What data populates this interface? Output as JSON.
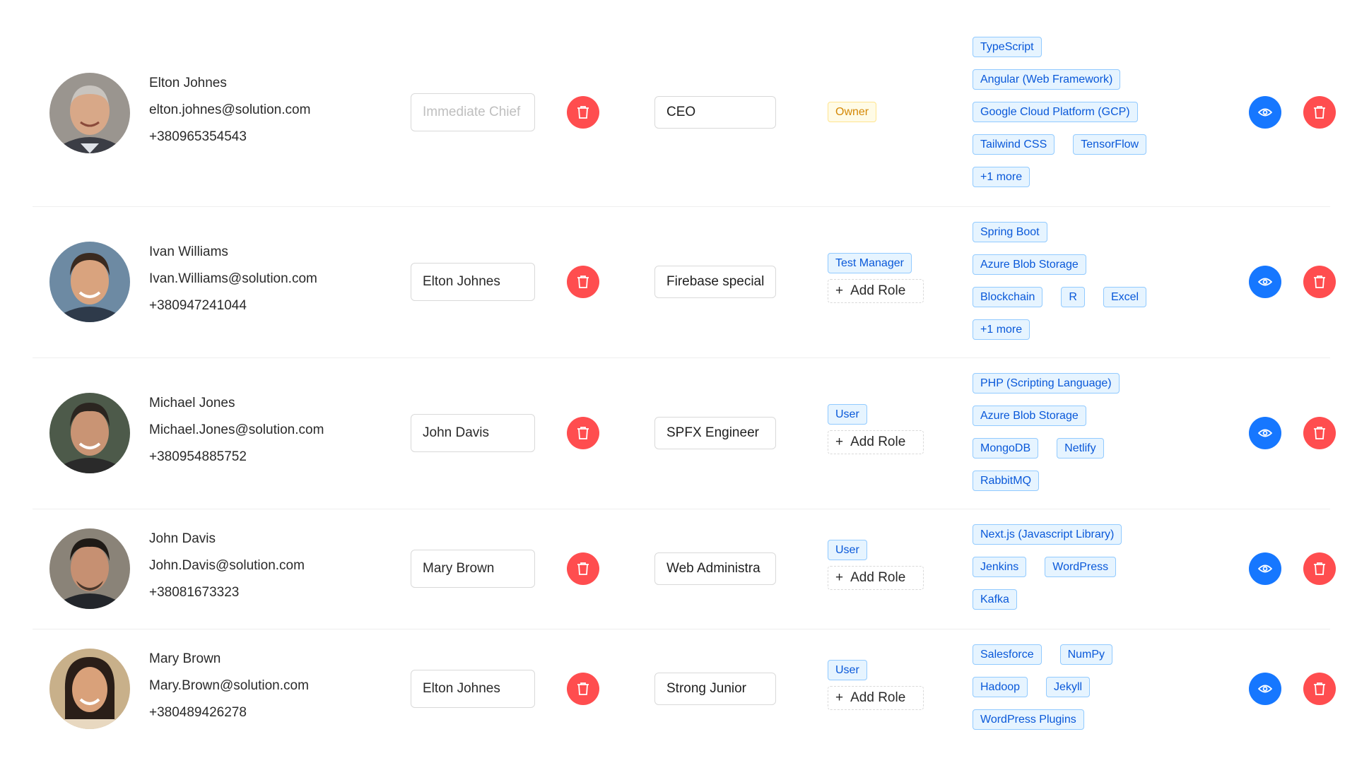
{
  "list": {
    "chief_placeholder": "Immediate Chief",
    "add_role_label": "Add Role",
    "colors": {
      "danger": "#ff4d4f",
      "primary": "#1677ff",
      "tag_blue_bg": "#e6f4ff",
      "tag_blue_border": "#91caff",
      "tag_blue_text": "#0958d9",
      "tag_gold_bg": "#fffbe6",
      "tag_gold_border": "#ffe58f",
      "tag_gold_text": "#d48806"
    },
    "employees": [
      {
        "name": "Elton Johnes",
        "email": "elton.johnes@solution.com",
        "phone": "+380965354543",
        "chief": "",
        "title": "CEO",
        "roles": [
          "Owner"
        ],
        "skills": [
          [
            "TypeScript"
          ],
          [
            "Angular (Web Framework)"
          ],
          [
            "Google Cloud Platform (GCP)"
          ],
          [
            "Tailwind CSS",
            "TensorFlow"
          ],
          [
            "+1 more"
          ]
        ]
      },
      {
        "name": "Ivan Williams",
        "email": "Ivan.Williams@solution.com",
        "phone": "+380947241044",
        "chief": "Elton Johnes",
        "title": "Firebase special",
        "roles": [
          "Test Manager"
        ],
        "skills": [
          [
            "Spring Boot"
          ],
          [
            "Azure Blob Storage"
          ],
          [
            "Blockchain",
            "R",
            "Excel"
          ],
          [
            "+1 more"
          ]
        ]
      },
      {
        "name": "Michael Jones",
        "email": "Michael.Jones@solution.com",
        "phone": "+380954885752",
        "chief": "John Davis",
        "title": "SPFX Engineer",
        "roles": [
          "User"
        ],
        "skills": [
          [
            "PHP (Scripting Language)"
          ],
          [
            "Azure Blob Storage"
          ],
          [
            "MongoDB",
            "Netlify"
          ],
          [
            "RabbitMQ"
          ]
        ]
      },
      {
        "name": "John Davis",
        "email": "John.Davis@solution.com",
        "phone": "+38081673323",
        "chief": "Mary Brown",
        "title": "Web Administra",
        "roles": [
          "User"
        ],
        "skills": [
          [
            "Next.js (Javascript Library)"
          ],
          [
            "Jenkins",
            "WordPress"
          ],
          [
            "Kafka"
          ]
        ]
      },
      {
        "name": "Mary Brown",
        "email": "Mary.Brown@solution.com",
        "phone": "+380489426278",
        "chief": "Elton Johnes",
        "title": "Strong Junior",
        "roles": [
          "User"
        ],
        "skills": [
          [
            "Salesforce",
            "NumPy"
          ],
          [
            "Hadoop",
            "Jekyll"
          ],
          [
            "WordPress Plugins"
          ]
        ]
      }
    ]
  }
}
